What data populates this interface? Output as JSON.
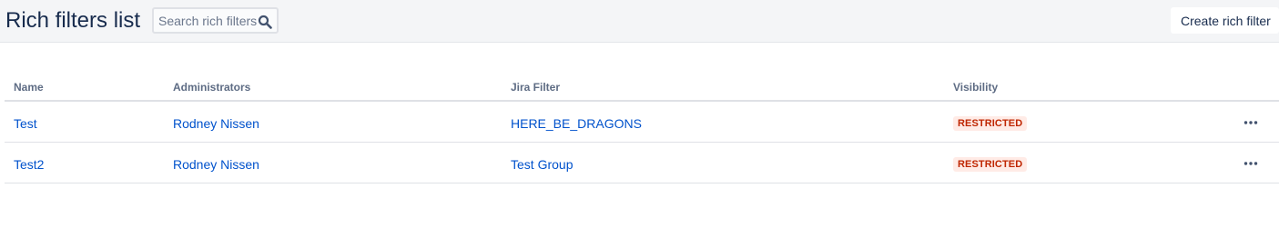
{
  "header": {
    "title": "Rich filters list",
    "search_placeholder": "Search rich filters",
    "search_value": "",
    "create_label": "Create rich filter",
    "search_icon": "search-icon"
  },
  "table": {
    "columns": [
      "Name",
      "Administrators",
      "Jira Filter",
      "Visibility"
    ],
    "rows": [
      {
        "name": "Test",
        "administrators": "Rodney Nissen",
        "jira_filter": "HERE_BE_DRAGONS",
        "visibility": "RESTRICTED",
        "actions_icon": "more-icon"
      },
      {
        "name": "Test2",
        "administrators": "Rodney Nissen",
        "jira_filter": "Test Group",
        "visibility": "RESTRICTED",
        "actions_icon": "more-icon"
      }
    ]
  },
  "colors": {
    "link": "#0052cc",
    "badge_bg": "#ffebe6",
    "badge_text": "#bf2600",
    "header_bg": "#f4f5f7"
  }
}
